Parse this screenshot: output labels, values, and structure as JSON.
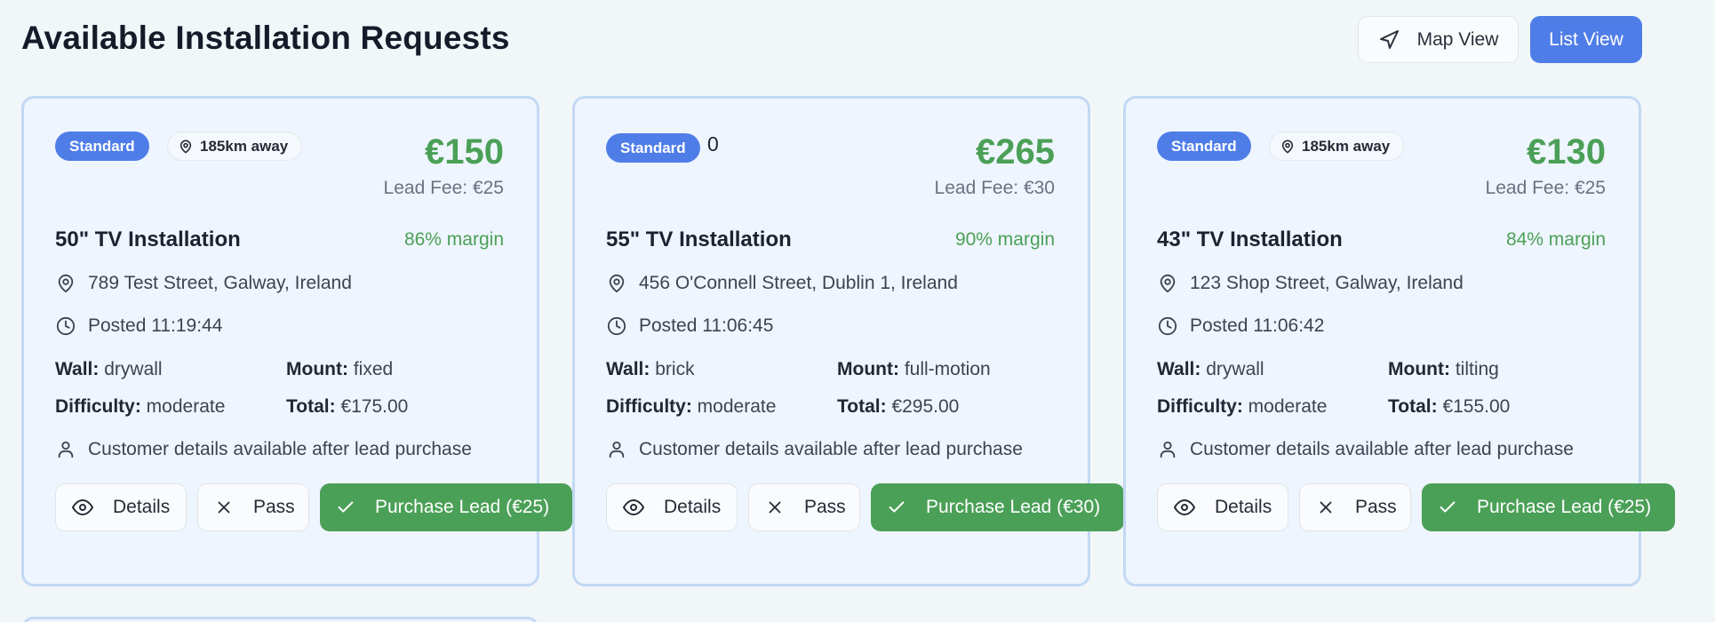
{
  "page": {
    "title": "Available Installation Requests",
    "view_toggle": {
      "map_label": "Map View",
      "list_label": "List View",
      "active": "List View"
    }
  },
  "colors": {
    "accent": "#4f7de8",
    "price_green": "#4ba057",
    "card_border": "#c3d8f3",
    "card_bg": "#eef5fe"
  },
  "cards": [
    {
      "badge": "Standard",
      "distance": "185km away",
      "price": "€150",
      "lead_fee": "Lead Fee: €25",
      "title": "50\" TV Installation",
      "margin": "86% margin",
      "address": "789 Test Street, Galway, Ireland",
      "posted": "Posted 11:19:44",
      "wall_label": "Wall:",
      "wall": "drywall",
      "mount_label": "Mount:",
      "mount": "fixed",
      "difficulty_label": "Difficulty:",
      "difficulty": "moderate",
      "total_label": "Total:",
      "total": "€175.00",
      "customer_note": "Customer details available after lead purchase",
      "details_label": "Details",
      "pass_label": "Pass",
      "purchase_label": "Purchase Lead (€25)"
    },
    {
      "badge": "Standard",
      "distance": "0",
      "price": "€265",
      "lead_fee": "Lead Fee: €30",
      "title": "55\" TV Installation",
      "margin": "90% margin",
      "address": "456 O'Connell Street, Dublin 1, Ireland",
      "posted": "Posted 11:06:45",
      "wall_label": "Wall:",
      "wall": "brick",
      "mount_label": "Mount:",
      "mount": "full-motion",
      "difficulty_label": "Difficulty:",
      "difficulty": "moderate",
      "total_label": "Total:",
      "total": "€295.00",
      "customer_note": "Customer details available after lead purchase",
      "details_label": "Details",
      "pass_label": "Pass",
      "purchase_label": "Purchase Lead (€30)"
    },
    {
      "badge": "Standard",
      "distance": "185km away",
      "price": "€130",
      "lead_fee": "Lead Fee: €25",
      "title": "43\" TV Installation",
      "margin": "84% margin",
      "address": "123 Shop Street, Galway, Ireland",
      "posted": "Posted 11:06:42",
      "wall_label": "Wall:",
      "wall": "drywall",
      "mount_label": "Mount:",
      "mount": "tilting",
      "difficulty_label": "Difficulty:",
      "difficulty": "moderate",
      "total_label": "Total:",
      "total": "€155.00",
      "customer_note": "Customer details available after lead purchase",
      "details_label": "Details",
      "pass_label": "Pass",
      "purchase_label": "Purchase Lead (€25)"
    }
  ]
}
